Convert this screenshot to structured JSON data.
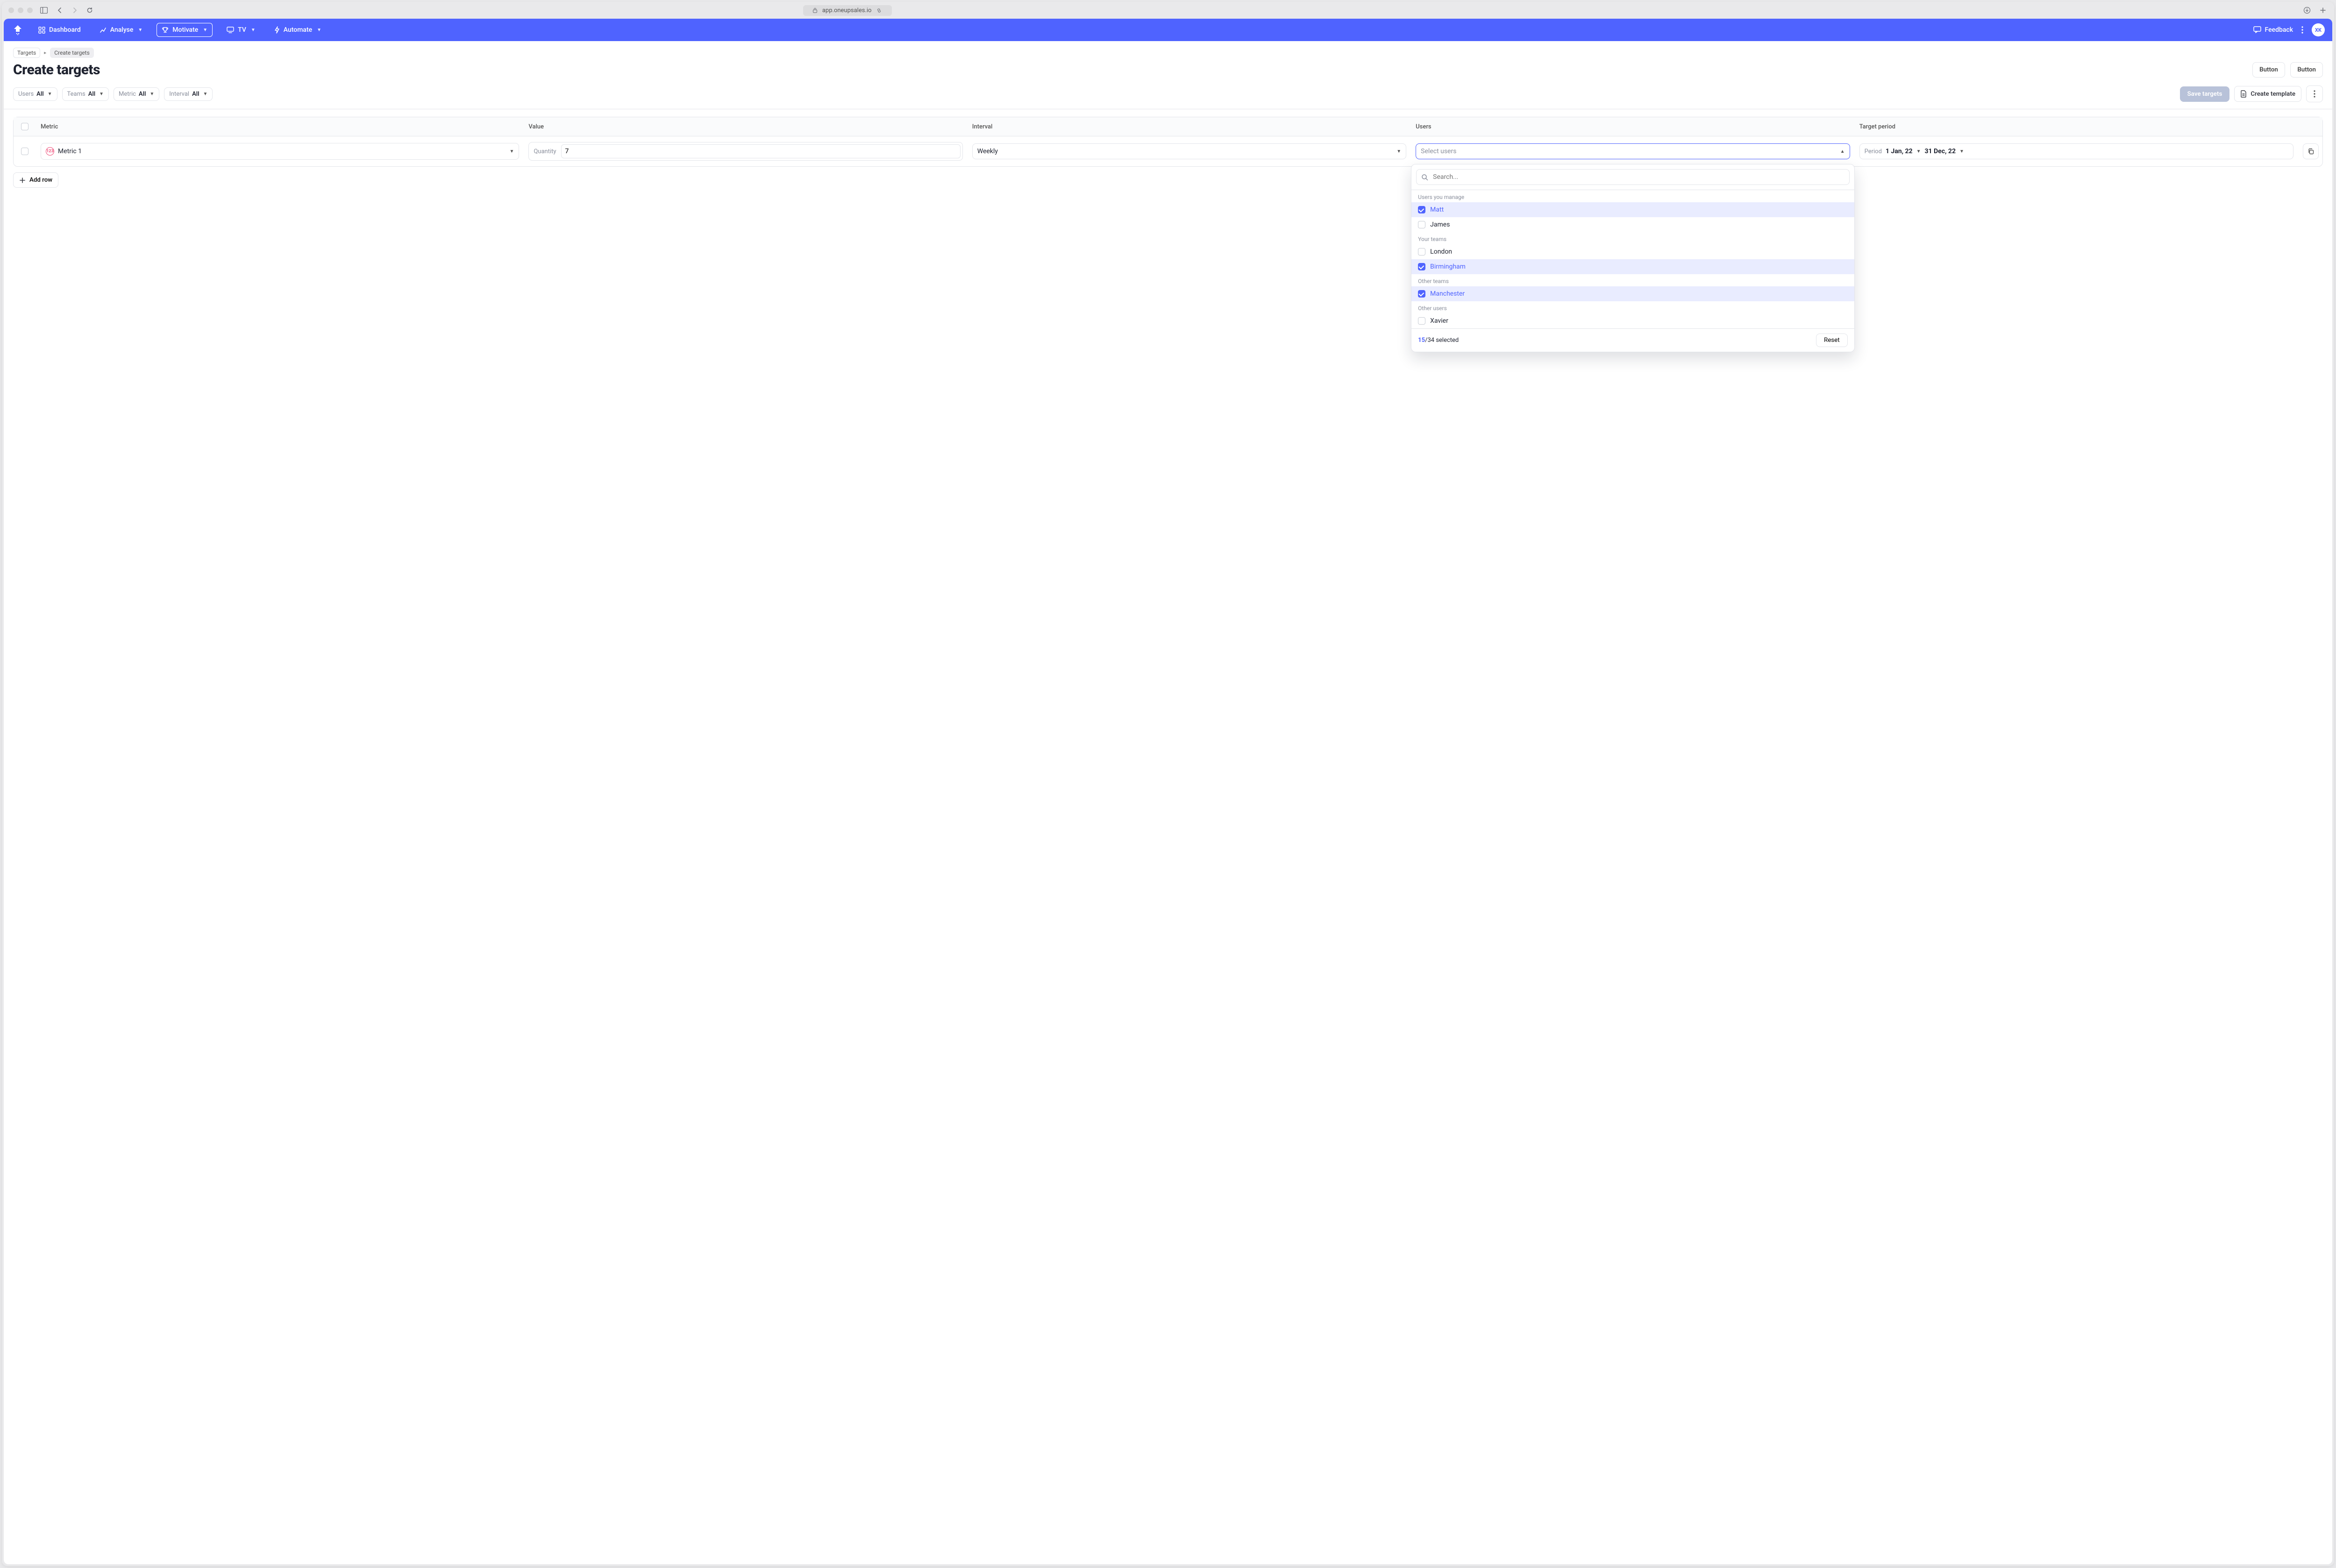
{
  "browser": {
    "url": "app.oneupsales.io"
  },
  "nav": {
    "items": [
      {
        "label": "Dashboard",
        "icon": "grid"
      },
      {
        "label": "Analyse",
        "icon": "chart",
        "caret": true
      },
      {
        "label": "Motivate",
        "icon": "trophy",
        "caret": true,
        "active": true
      },
      {
        "label": "TV",
        "icon": "tv",
        "caret": true
      },
      {
        "label": "Automate",
        "icon": "bolt",
        "caret": true
      }
    ],
    "feedback": "Feedback",
    "avatar": "XK"
  },
  "breadcrumbs": {
    "root": "Targets",
    "current": "Create targets"
  },
  "page": {
    "title": "Create targets",
    "header_btn": "Button"
  },
  "filters": {
    "users": {
      "label": "Users",
      "value": "All"
    },
    "teams": {
      "label": "Teams",
      "value": "All"
    },
    "metric": {
      "label": "Metric",
      "value": "All"
    },
    "interval": {
      "label": "Interval",
      "value": "All"
    }
  },
  "actions": {
    "save": "Save targets",
    "template": "Create template"
  },
  "table": {
    "headers": {
      "metric": "Metric",
      "value": "Value",
      "interval": "Interval",
      "users": "Users",
      "period": "Target period"
    },
    "row": {
      "metric": {
        "chip": "123",
        "name": "Metric 1"
      },
      "value": {
        "label": "Quantity",
        "input": "7"
      },
      "interval": "Weekly",
      "users_placeholder": "Select users",
      "period": {
        "label": "Period",
        "from": "1 Jan, 22",
        "to": "31 Dec, 22"
      }
    },
    "add_row": "Add row"
  },
  "dropdown": {
    "search_placeholder": "Search...",
    "sections": {
      "manage": "Users you manage",
      "your_teams": "Your teams",
      "other_teams": "Other teams",
      "other_users": "Other users"
    },
    "items": {
      "matt": "Matt",
      "james": "James",
      "london": "London",
      "birmingham": "Birmingham",
      "manchester": "Manchester",
      "xavier": "Xavier"
    },
    "footer": {
      "selected": "15",
      "total": "34",
      "suffix": " selected",
      "reset": "Reset"
    }
  }
}
